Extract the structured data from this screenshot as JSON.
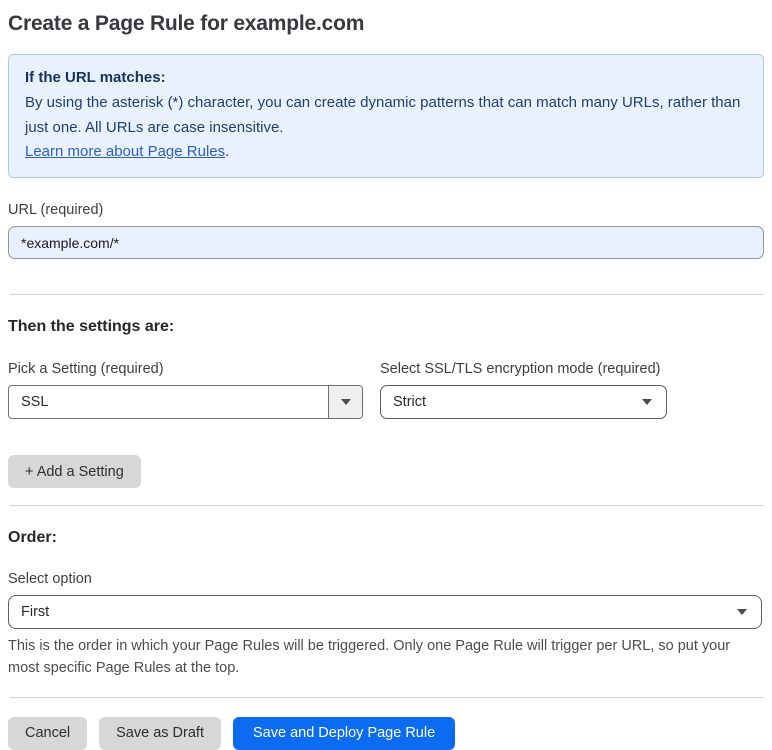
{
  "page": {
    "title": "Create a Page Rule for example.com"
  },
  "info_box": {
    "heading": "If the URL matches:",
    "body": "By using the asterisk (*) character, you can create dynamic patterns that can match many URLs, rather than just one. All URLs are case insensitive.",
    "link_label": "Learn more about Page Rules",
    "link_suffix": "."
  },
  "url_field": {
    "label": "URL (required)",
    "value": "*example.com/*"
  },
  "settings": {
    "heading": "Then the settings are:",
    "setting_select": {
      "label": "Pick a Setting (required)",
      "selected": "SSL"
    },
    "mode_select": {
      "label": "Select SSL/TLS encryption mode (required)",
      "selected": "Strict"
    },
    "add_button_label": "+ Add a Setting"
  },
  "order": {
    "heading": "Order:",
    "select_label": "Select option",
    "selected": "First",
    "help_text": "This is the order in which your Page Rules will be triggered. Only one Page Rule will trigger per URL, so put your most specific Page Rules at the top."
  },
  "footer": {
    "cancel_label": "Cancel",
    "save_draft_label": "Save as Draft",
    "save_deploy_label": "Save and Deploy Page Rule"
  },
  "colors": {
    "primary_button_blue": "#0b6cf2",
    "info_box_background": "#e9f2fc",
    "info_box_border": "#a9cbec",
    "info_box_text": "#1e3f72",
    "link_blue": "#2b5fc7",
    "url_input_background": "#e8f0fe",
    "gray_button_background": "#d7d7d7"
  }
}
